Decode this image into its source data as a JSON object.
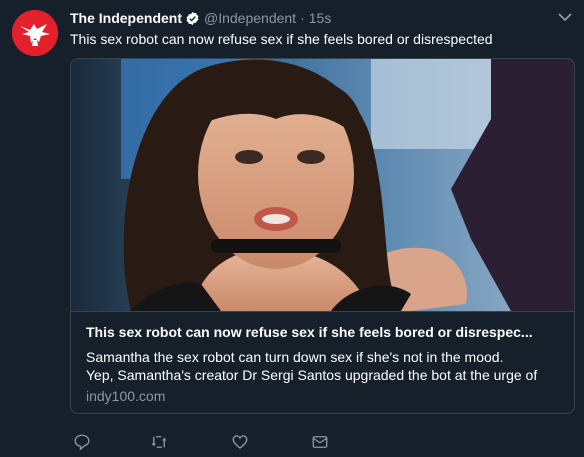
{
  "tweet": {
    "author_name": "The Independent",
    "handle": "@Independent",
    "separator": "·",
    "time": "15s",
    "text": "This sex robot can now refuse sex if she feels bored or disrespected"
  },
  "card": {
    "title": "This sex robot can now refuse sex if she feels bored or disrespec...",
    "description_line1": "Samantha the sex robot can turn down sex if she's not in the mood.",
    "description_line2": "Yep, Samantha's creator Dr Sergi Santos upgraded the bot at the urge of",
    "domain": "indy100.com"
  },
  "icons": {
    "avatar": "independent-eagle-logo",
    "verified": "verified-badge-icon",
    "more": "chevron-down-icon",
    "reply": "reply-icon",
    "retweet": "retweet-icon",
    "like": "heart-icon",
    "message": "envelope-icon"
  },
  "colors": {
    "background": "#15202b",
    "border": "#38444d",
    "muted": "#8899a6",
    "brand_red": "#e4202c"
  }
}
